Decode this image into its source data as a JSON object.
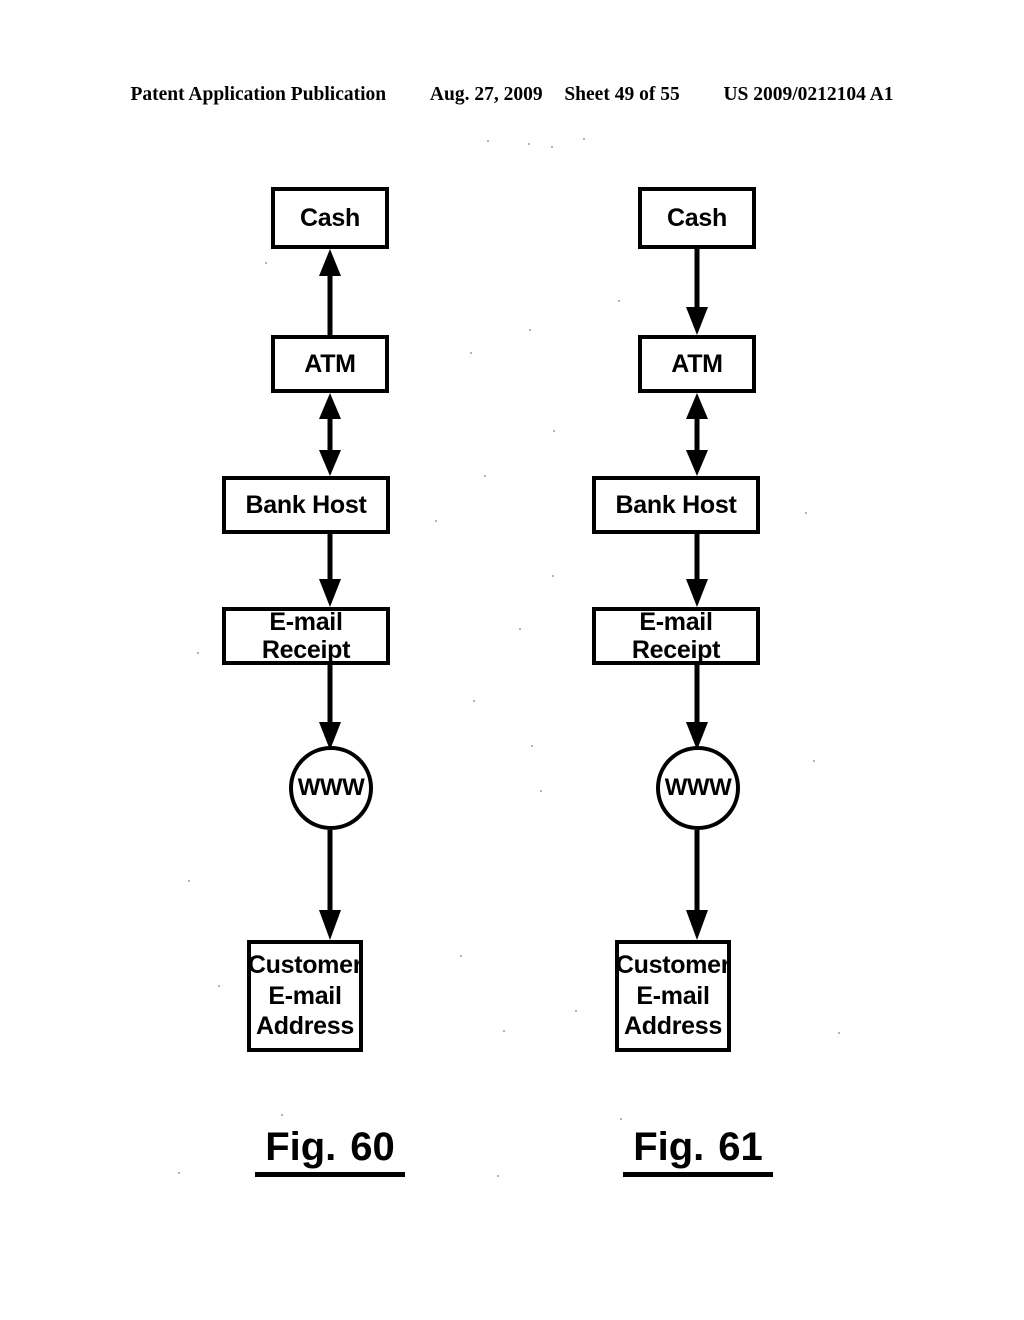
{
  "header": {
    "publication": "Patent Application Publication",
    "date": "Aug. 27, 2009",
    "sheet": "Sheet 49 of 55",
    "patent_number": "US 2009/0212104 A1"
  },
  "figures": [
    {
      "id": "figure-60",
      "caption_prefix": "Fig.",
      "caption_number": "60",
      "nodes": {
        "cash": "Cash",
        "atm": "ATM",
        "bank_host": "Bank Host",
        "email_receipt": "E-mail Receipt",
        "www": "WWW",
        "customer_line1": "Customer",
        "customer_line2": "E-mail",
        "customer_line3": "Address"
      },
      "connectors": [
        {
          "name": "atm-to-cash",
          "direction": "up"
        },
        {
          "name": "atm-bank-host",
          "direction": "both"
        },
        {
          "name": "bank-host-to-email-receipt",
          "direction": "down"
        },
        {
          "name": "email-receipt-to-www",
          "direction": "down"
        },
        {
          "name": "www-to-customer-email-address",
          "direction": "down"
        }
      ]
    },
    {
      "id": "figure-61",
      "caption_prefix": "Fig.",
      "caption_number": "61",
      "nodes": {
        "cash": "Cash",
        "atm": "ATM",
        "bank_host": "Bank Host",
        "email_receipt": "E-mail Receipt",
        "www": "WWW",
        "customer_line1": "Customer",
        "customer_line2": "E-mail",
        "customer_line3": "Address"
      },
      "connectors": [
        {
          "name": "cash-to-atm",
          "direction": "down"
        },
        {
          "name": "atm-bank-host",
          "direction": "both"
        },
        {
          "name": "bank-host-to-email-receipt",
          "direction": "down"
        },
        {
          "name": "email-receipt-to-www",
          "direction": "down"
        },
        {
          "name": "www-to-customer-email-address",
          "direction": "down"
        }
      ]
    }
  ],
  "colors": {
    "ink": "#000000",
    "paper": "#ffffff"
  }
}
